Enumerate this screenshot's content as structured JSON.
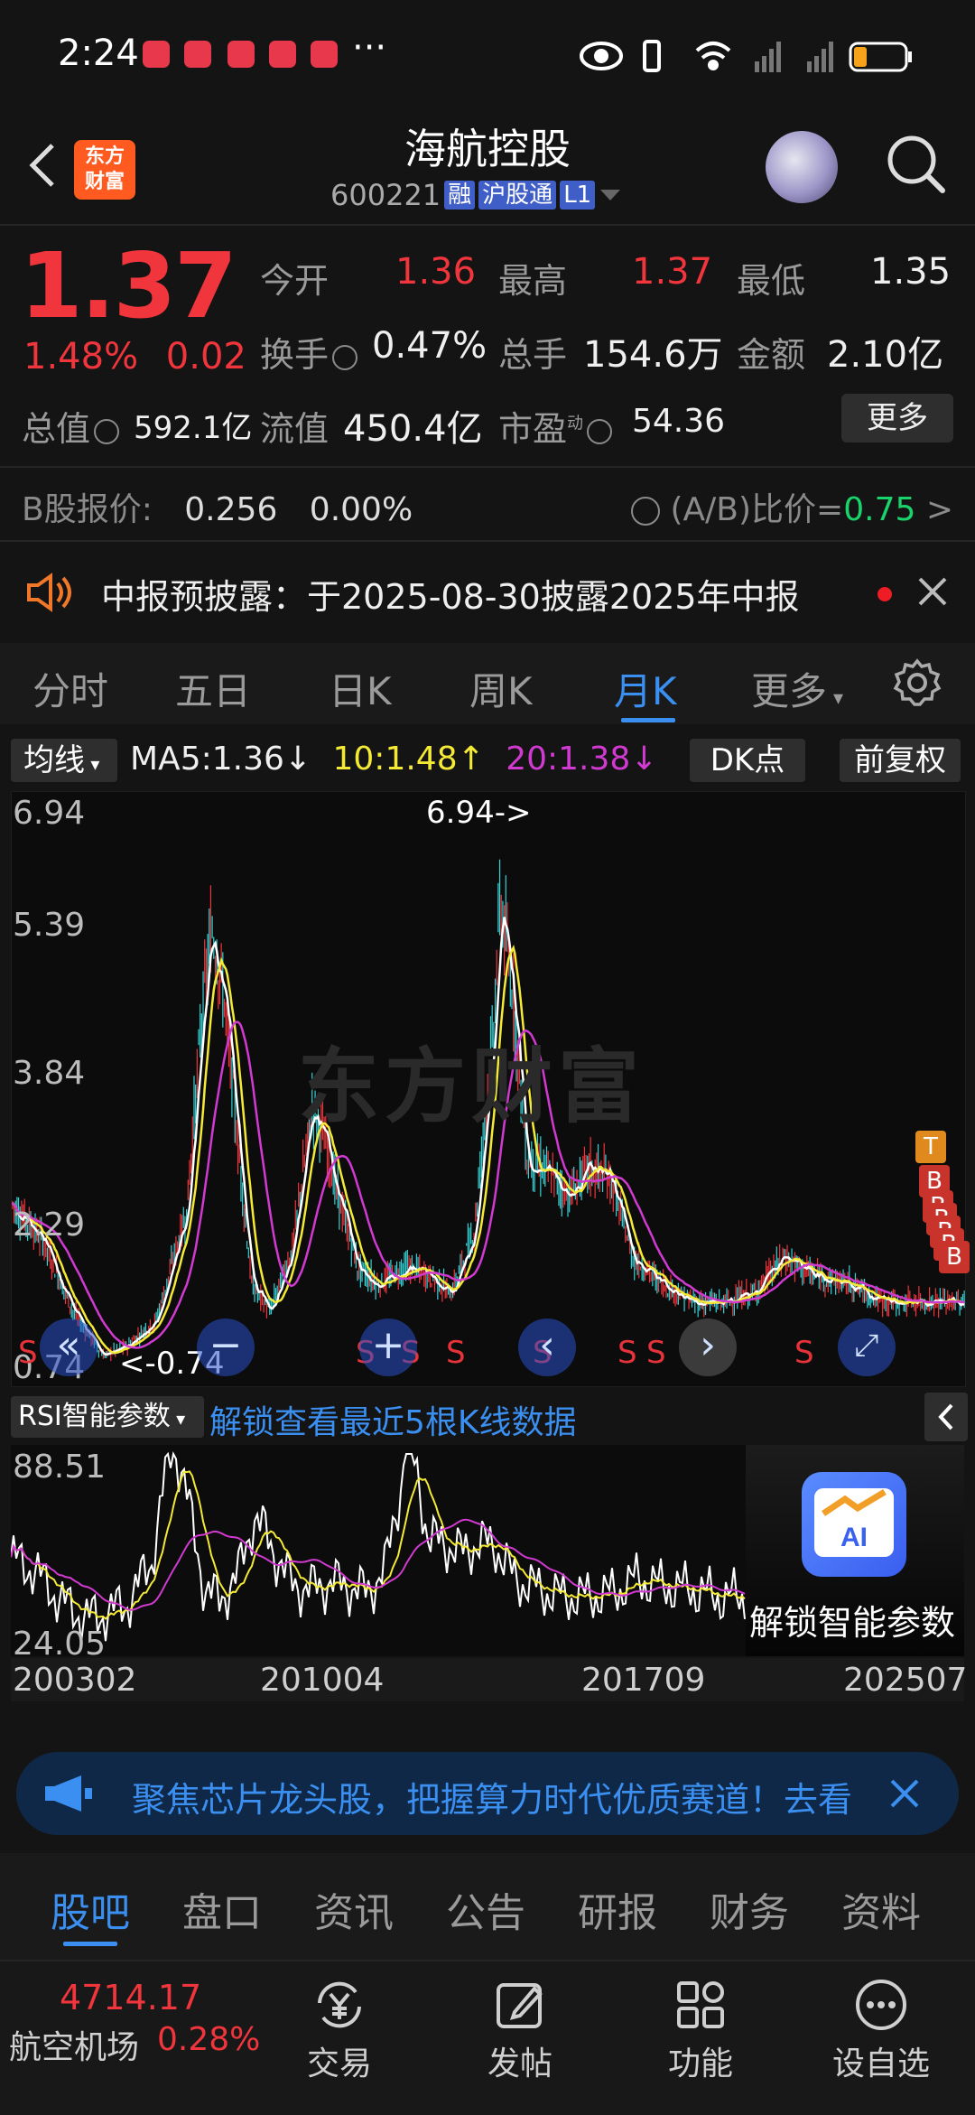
{
  "status_bar": {
    "time": "2:24",
    "dots": "···"
  },
  "header": {
    "title": "海航控股",
    "code": "600221",
    "tags": [
      "融",
      "沪股通",
      "L1"
    ],
    "logo_text": "东方财富"
  },
  "quote": {
    "price": "1.37",
    "change_pct": "1.48%",
    "change_abs": "0.02",
    "rows": [
      [
        {
          "label": "今开",
          "value": "1.36",
          "color": "red"
        },
        {
          "label": "最高",
          "value": "1.37",
          "color": "red"
        },
        {
          "label": "最低",
          "value": "1.35",
          "color": "white"
        }
      ],
      [
        {
          "label": "换手",
          "value": "0.47%",
          "color": "white"
        },
        {
          "label": "总手",
          "value": "154.6万",
          "color": "white"
        },
        {
          "label": "金额",
          "value": "2.10亿",
          "color": "white"
        }
      ],
      [
        {
          "label": "总值",
          "value": "592.1亿",
          "color": "white"
        },
        {
          "label": "流值",
          "value": "450.4亿",
          "color": "white"
        },
        {
          "label": "市盈",
          "value": "54.36",
          "color": "white",
          "sup": "动"
        }
      ]
    ],
    "more": "更多",
    "b_share_label": "B股报价:",
    "b_share_price": "0.256",
    "b_share_pct": "0.00%",
    "ab_ratio_label": "(A/B)比价=",
    "ab_ratio_value": "0.75"
  },
  "announcement": {
    "text": "中报预披露：于2025-08-30披露2025年中报"
  },
  "tabs": [
    "分时",
    "五日",
    "日K",
    "周K",
    "月K",
    "更多"
  ],
  "active_tab": "月K",
  "ma_row": {
    "junxian": "均线",
    "ma5": "MA5:1.36↓",
    "ma10": "10:1.48↑",
    "ma20": "20:1.38↓",
    "dk": "DK点",
    "fq": "前复权"
  },
  "main_chart": {
    "y_ticks": [
      "6.94",
      "5.39",
      "3.84",
      "2.29",
      "0.74"
    ],
    "peak_note": "6.94->",
    "low_note": "<-0.74",
    "watermark": "东方财富",
    "s_marks": [
      "S",
      "S",
      "S",
      "S",
      "S",
      "S",
      "S",
      "S"
    ],
    "tb_marks": [
      "T",
      "B",
      "B",
      "B",
      "B",
      "B",
      "B"
    ]
  },
  "rsi": {
    "button": "RSI智能参数",
    "link": "解锁查看最近5根K线数据",
    "y_ticks": [
      "88.51",
      "24.05"
    ],
    "ai_label": "解锁智能参数",
    "ai_icon_text": "AI"
  },
  "x_axis": [
    "200302",
    "201004",
    "201709",
    "202507"
  ],
  "banner": {
    "text": "聚焦芯片龙头股，把握算力时代优质赛道！去看"
  },
  "bottom_tabs": [
    "股吧",
    "盘口",
    "资讯",
    "公告",
    "研报",
    "财务",
    "资料"
  ],
  "active_bottom_tab": "股吧",
  "bottom_bar": {
    "index_value": "4714.17",
    "index_name": "航空机场",
    "index_pct": "0.28%",
    "buttons": [
      {
        "label": "交易",
        "icon": "yen-trade-icon"
      },
      {
        "label": "发帖",
        "icon": "edit-post-icon"
      },
      {
        "label": "功能",
        "icon": "grid-function-icon"
      },
      {
        "label": "设自选",
        "icon": "more-dots-icon"
      }
    ]
  },
  "chart_data": {
    "type": "line",
    "title": "",
    "ylim": [
      0.74,
      6.94
    ],
    "x_ticks": [
      "200302",
      "201004",
      "201709",
      "202507"
    ],
    "series": [
      {
        "name": "MA5",
        "last_value": 1.36
      },
      {
        "name": "10",
        "last_value": 1.48
      },
      {
        "name": "20",
        "last_value": 1.38
      }
    ],
    "colors": {
      "ma5": "#ffffff",
      "ma10": "#f4ea36",
      "ma20": "#d13ad0",
      "up": "#f0353c",
      "down": "#36d2d6"
    }
  }
}
